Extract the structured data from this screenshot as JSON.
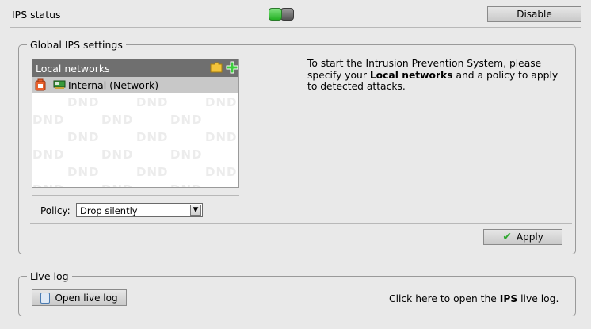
{
  "status": {
    "label": "IPS status",
    "toggle_state": "on",
    "disable_label": "Disable"
  },
  "global": {
    "legend": "Global IPS settings",
    "networks": {
      "title": "Local networks",
      "icons": [
        "folder-icon",
        "add-icon"
      ],
      "items": [
        {
          "label": "Internal (Network)",
          "icons": [
            "delete-icon",
            "network-card-icon"
          ]
        }
      ],
      "watermark": "DND"
    },
    "policy": {
      "label": "Policy:",
      "value": "Drop silently"
    },
    "info": {
      "part1": "To start the Intrusion Prevention System, please specify your ",
      "bold": "Local networks",
      "part2": " and a policy to apply to detected attacks."
    },
    "apply_label": "Apply"
  },
  "livelog": {
    "legend": "Live log",
    "button_label": "Open live log",
    "text_part1": "Click here to open the ",
    "text_bold": "IPS",
    "text_part2": " live log."
  },
  "colors": {
    "toggle_on": "#23b023",
    "header_bg": "#6f6f6f",
    "selected_row": "#c8c8c8"
  }
}
